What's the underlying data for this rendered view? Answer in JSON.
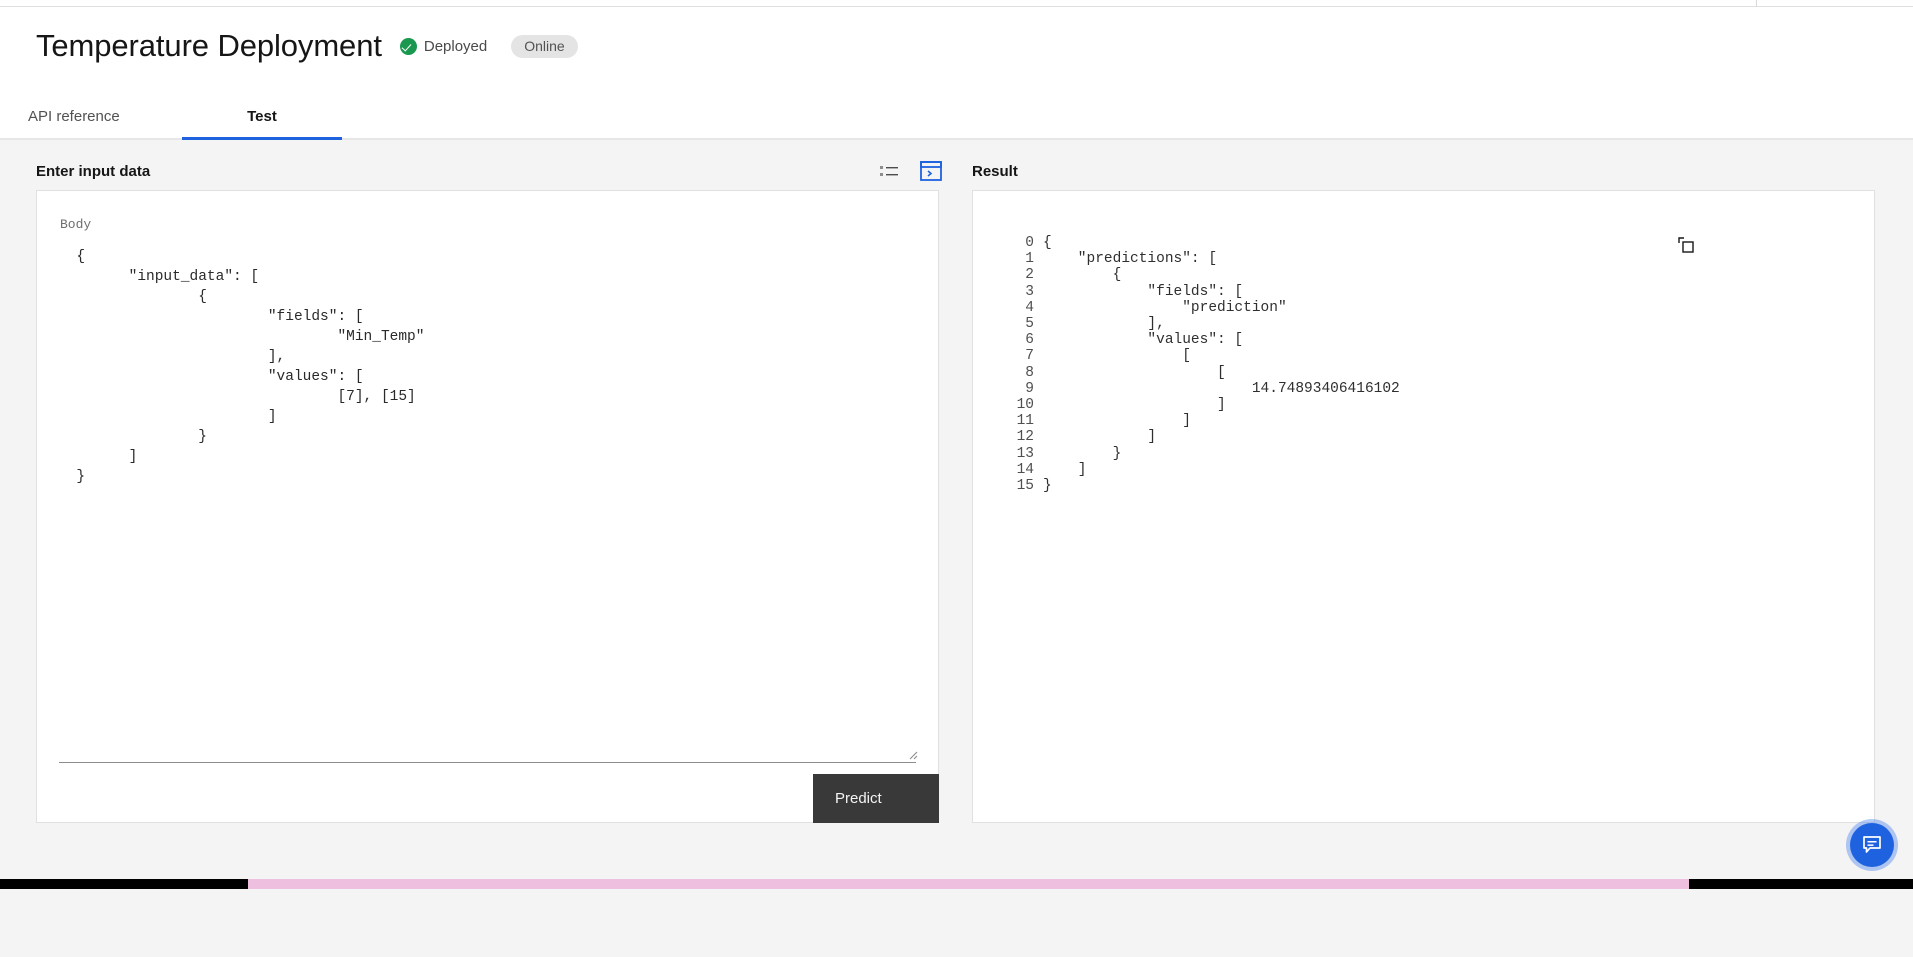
{
  "header": {
    "title": "Temperature Deployment",
    "status_icon": "check-circle-icon",
    "status_label": "Deployed",
    "online_badge": "Online"
  },
  "tabs": [
    {
      "label": "API reference",
      "active": false
    },
    {
      "label": "Test",
      "active": true
    }
  ],
  "input_panel": {
    "label": "Enter input data",
    "body_label": "Body",
    "view_icons": [
      {
        "name": "list-view-icon",
        "active": false
      },
      {
        "name": "form-view-icon",
        "active": true
      }
    ],
    "code": "  {\n        \"input_data\": [\n                {\n                        \"fields\": [\n                                \"Min_Temp\"\n                        ],\n                        \"values\": [\n                                [7], [15]\n                        ]\n                }\n        ]\n  }",
    "placeholder": "Enter input data",
    "predict_label": "Predict"
  },
  "result_panel": {
    "label": "Result",
    "copy_icon": "copy-icon",
    "lines": [
      {
        "n": "0",
        "text": "{"
      },
      {
        "n": "1",
        "text": "    \"predictions\": ["
      },
      {
        "n": "2",
        "text": "        {"
      },
      {
        "n": "3",
        "text": "            \"fields\": ["
      },
      {
        "n": "4",
        "text": "                \"prediction\""
      },
      {
        "n": "5",
        "text": "            ],"
      },
      {
        "n": "6",
        "text": "            \"values\": ["
      },
      {
        "n": "7",
        "text": "                ["
      },
      {
        "n": "8",
        "text": "                    ["
      },
      {
        "n": "9",
        "text": "                        14.74893406416102"
      },
      {
        "n": "10",
        "text": "                    ]"
      },
      {
        "n": "11",
        "text": "                ]"
      },
      {
        "n": "12",
        "text": "            ]"
      },
      {
        "n": "13",
        "text": "        }"
      },
      {
        "n": "14",
        "text": "    ]"
      },
      {
        "n": "15",
        "text": "}"
      }
    ]
  },
  "chat_fab": {
    "icon": "chat-bubble-icon"
  },
  "colors": {
    "accent_blue": "#1f62e0",
    "status_green": "#1a9850",
    "button_dark": "#393939",
    "page_bg": "#f4f4f4",
    "panel_bg": "#ffffff",
    "bottom_pink": "#efbfe0"
  }
}
